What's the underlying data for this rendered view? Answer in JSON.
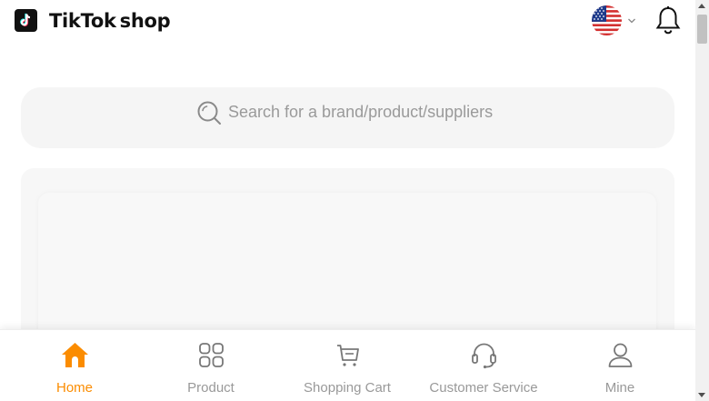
{
  "header": {
    "brand_name": "TikTok",
    "brand_suffix": "shop",
    "logo_icon": "tiktok-note-icon",
    "language_flag": "us-flag-icon",
    "notification_icon": "bell-icon"
  },
  "search": {
    "placeholder": "Search for a brand/product/suppliers",
    "icon": "search-icon"
  },
  "bottom_nav": {
    "items": [
      {
        "label": "Home",
        "icon": "home-icon",
        "active": true
      },
      {
        "label": "Product",
        "icon": "grid-icon",
        "active": false
      },
      {
        "label": "Shopping Cart",
        "icon": "cart-icon",
        "active": false
      },
      {
        "label": "Customer Service",
        "icon": "headset-icon",
        "active": false
      },
      {
        "label": "Mine",
        "icon": "user-icon",
        "active": false
      }
    ]
  },
  "colors": {
    "accent": "#fb8c00",
    "inactive": "#999999",
    "search_bg": "#f5f5f5"
  }
}
